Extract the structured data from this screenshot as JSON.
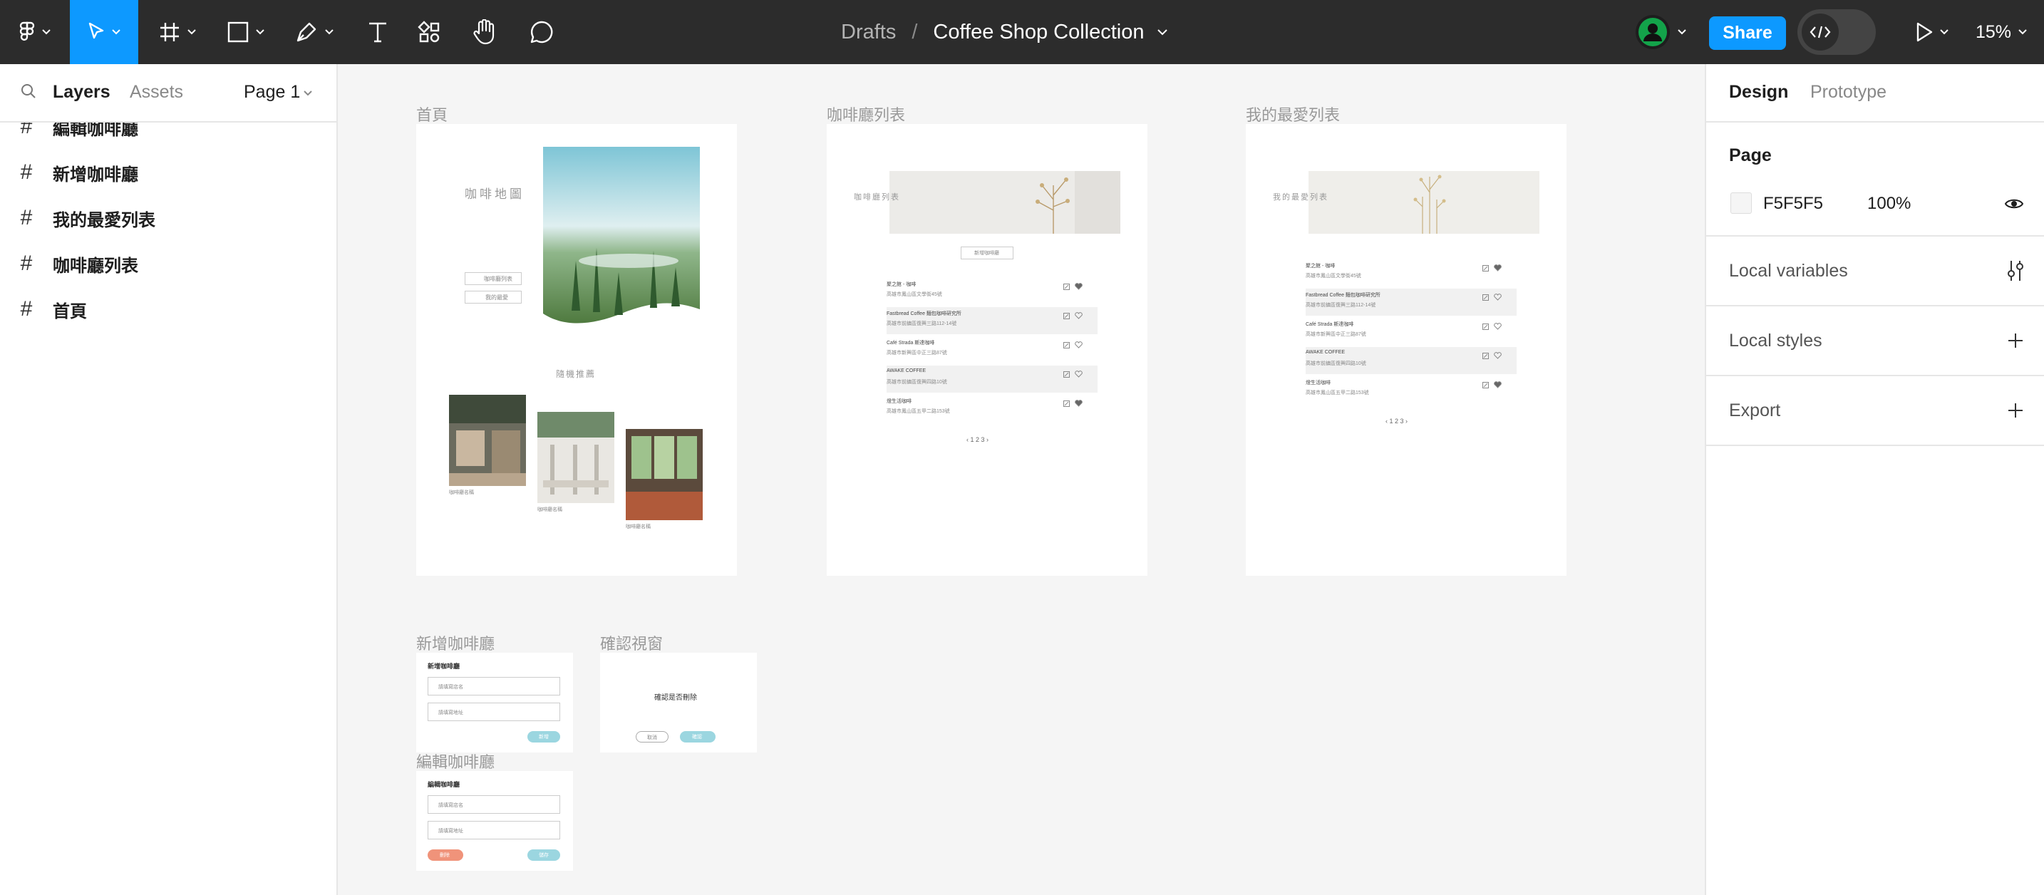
{
  "toolbar": {
    "breadcrumb_root": "Drafts",
    "breadcrumb_sep": "/",
    "file_name": "Coffee Shop Collection",
    "share_label": "Share",
    "zoom": "15%",
    "tools": [
      "main-menu-icon",
      "move-tool-icon",
      "frame-tool-icon",
      "shape-tool-icon",
      "pen-tool-icon",
      "text-tool-icon",
      "resources-icon",
      "hand-tool-icon",
      "comment-tool-icon"
    ]
  },
  "left_panel": {
    "tabs": {
      "layers": "Layers",
      "assets": "Assets"
    },
    "page_selector": "Page 1",
    "layers": [
      "編輯咖啡廳",
      "新增咖啡廳",
      "我的最愛列表",
      "咖啡廳列表",
      "首頁"
    ]
  },
  "right_panel": {
    "tabs": {
      "design": "Design",
      "prototype": "Prototype"
    },
    "page_section": {
      "title": "Page",
      "color_hex": "F5F5F5",
      "opacity": "100%"
    },
    "sections": [
      "Local variables",
      "Local styles",
      "Export"
    ]
  },
  "canvas": {
    "background": "#F5F5F5",
    "frames": {
      "home": {
        "label": "首頁",
        "title": "咖啡地圖",
        "btn1": "咖啡廳列表",
        "btn2": "我的最愛",
        "section": "隨機推薦",
        "cap1": "咖啡廳名稱",
        "cap2": "咖啡廳名稱",
        "cap3": "咖啡廳名稱"
      },
      "list": {
        "label": "咖啡廳列表",
        "hero": "咖啡廳列表",
        "add_btn": "新增咖啡廳",
        "rows": [
          {
            "name": "聚之館 - 咖啡",
            "addr": "高雄市鳳山區文學街45號",
            "fav": true
          },
          {
            "name": "Fastbread Coffee 麵包咖啡研究所",
            "addr": "高雄市前鎮區復興三路112-14號",
            "fav": false
          },
          {
            "name": "Café Strada 斯達咖啡",
            "addr": "高雄市新興區中正三路87號",
            "fav": false
          },
          {
            "name": "AWAKE COFFEE",
            "addr": "高雄市前鎮區復興四路10號",
            "fav": false
          },
          {
            "name": "燈生活咖啡",
            "addr": "高雄市鳳山區五甲二路153號",
            "fav": true
          }
        ],
        "pager": "‹  1 2 3  ›"
      },
      "favorites": {
        "label": "我的最愛列表",
        "hero": "我的最愛列表",
        "rows": [
          {
            "name": "聚之館 - 咖啡",
            "addr": "高雄市鳳山區文學街45號",
            "fav": true
          },
          {
            "name": "Fastbread Coffee 麵包咖啡研究所",
            "addr": "高雄市前鎮區復興三路112-14號",
            "fav": false
          },
          {
            "name": "Café Strada 斯達咖啡",
            "addr": "高雄市新興區中正三路87號",
            "fav": false
          },
          {
            "name": "AWAKE COFFEE",
            "addr": "高雄市前鎮區復興四路10號",
            "fav": false
          },
          {
            "name": "燈生活咖啡",
            "addr": "高雄市鳳山區五甲二路153號",
            "fav": true
          }
        ],
        "pager": "‹  1 2 3  ›"
      },
      "add": {
        "label": "新增咖啡廳",
        "title": "新增咖啡廳",
        "field1": "請填寫店名",
        "field2": "請填寫地址",
        "submit": "新增"
      },
      "confirm": {
        "label": "確認視窗",
        "message": "確認是否刪除",
        "cancel": "取消",
        "ok": "確認"
      },
      "edit": {
        "label": "編輯咖啡廳",
        "title": "編輯咖啡廳",
        "field1": "請填寫店名",
        "field2": "請填寫地址",
        "delete": "刪除",
        "save": "儲存"
      }
    }
  }
}
